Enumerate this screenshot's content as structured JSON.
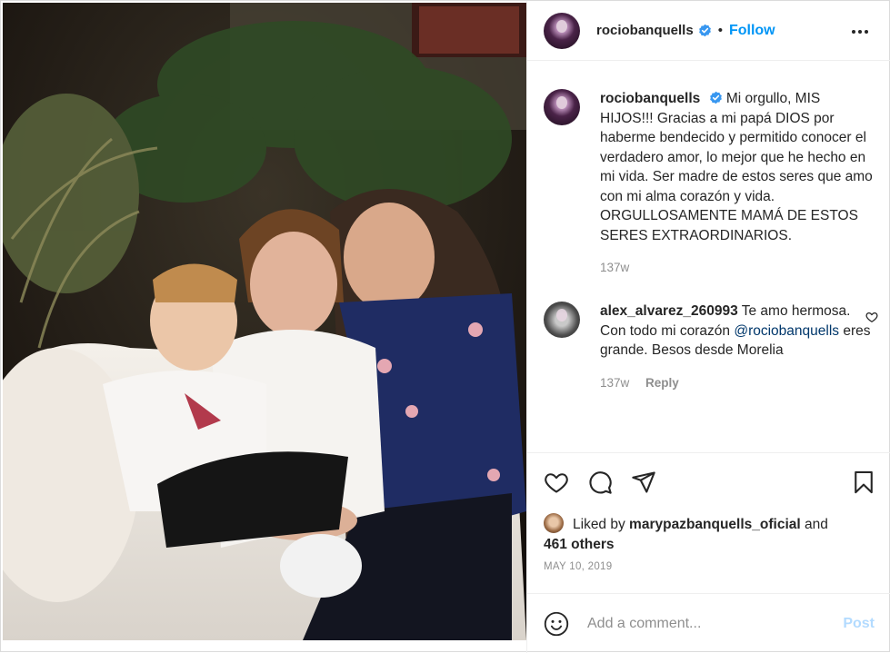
{
  "post": {
    "username": "rociobanquells",
    "follow_label": "Follow",
    "dot": "•",
    "caption_user": "rociobanquells",
    "caption_text": "Mi orgullo, MIS HIJOS!!! Gracias a mi papá DIOS por haberme bendecido y permitido conocer el verdadero amor, lo mejor que he hecho en mi vida. Ser madre de estos seres que amo con mi alma corazón y vida. ORGULLOSAMENTE MAMÁ DE ESTOS SERES EXTRAORDINARIOS.",
    "caption_time": "137w"
  },
  "comment": {
    "user": "alex_alvarez_260993",
    "text_before": "Te amo hermosa. Con todo mi corazón",
    "mention": "@rociobanquells",
    "text_after": "eres grande. Besos desde Morelia",
    "time": "137w",
    "reply_label": "Reply"
  },
  "likes": {
    "prefix": "Liked by",
    "user": "marypazbanquells_oficial",
    "and": "and",
    "others": "461 others"
  },
  "date": "MAY 10, 2019",
  "add_comment": {
    "placeholder": "Add a comment...",
    "post_label": "Post"
  },
  "colors": {
    "accent": "#0095f6",
    "post_disabled": "#b3dbff",
    "muted": "#8e8e8e",
    "mention": "#00376b"
  },
  "icons": [
    "verified-badge-icon",
    "more-options-icon",
    "heart-icon",
    "comment-icon",
    "share-icon",
    "bookmark-icon",
    "emoji-icon"
  ]
}
